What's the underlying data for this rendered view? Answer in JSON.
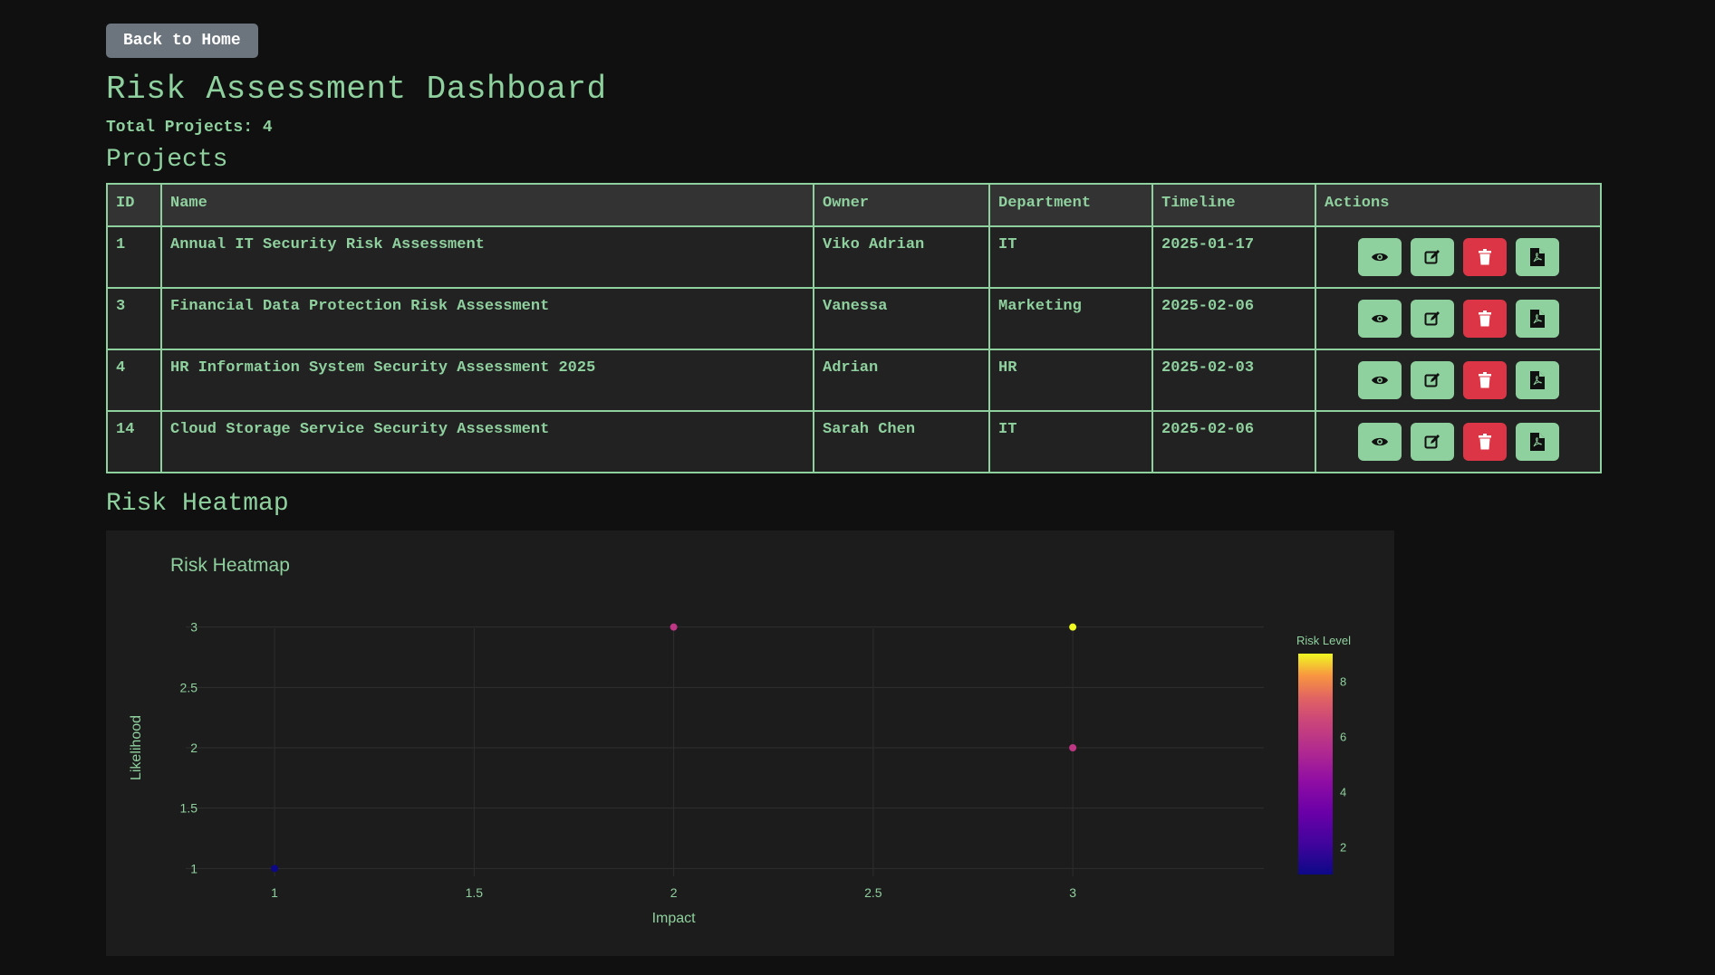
{
  "nav": {
    "back_label": "Back to Home"
  },
  "header": {
    "title": "Risk Assessment Dashboard",
    "total_projects": "Total Projects: 4"
  },
  "projects": {
    "section_title": "Projects",
    "columns": [
      "ID",
      "Name",
      "Owner",
      "Department",
      "Timeline",
      "Actions"
    ],
    "rows": [
      {
        "id": "1",
        "name": "Annual IT Security Risk Assessment",
        "owner": "Viko Adrian",
        "department": "IT",
        "timeline": "2025-01-17"
      },
      {
        "id": "3",
        "name": "Financial Data Protection Risk Assessment",
        "owner": "Vanessa",
        "department": "Marketing",
        "timeline": "2025-02-06"
      },
      {
        "id": "4",
        "name": "HR Information System Security Assessment 2025",
        "owner": "Adrian",
        "department": "HR",
        "timeline": "2025-02-03"
      },
      {
        "id": "14",
        "name": "Cloud Storage Service Security Assessment",
        "owner": "Sarah Chen",
        "department": "IT",
        "timeline": "2025-02-06"
      }
    ],
    "action_icons": [
      "eye-icon",
      "edit-icon",
      "trash-icon",
      "pdf-icon"
    ]
  },
  "heatmap_section": {
    "title": "Risk Heatmap"
  },
  "colors": {
    "accent": "#8fd19e",
    "danger": "#dc3545",
    "secondary": "#6c757d",
    "background": "#101010"
  },
  "chart_data": {
    "type": "scatter",
    "title": "Risk Heatmap",
    "xlabel": "Impact",
    "ylabel": "Likelihood",
    "xlim": [
      0.85,
      3.12
    ],
    "ylim": [
      0.95,
      3.05
    ],
    "xticks": [
      1,
      1.5,
      2,
      2.5,
      3
    ],
    "yticks": [
      1,
      1.5,
      2,
      2.5,
      3
    ],
    "grid": true,
    "colorbar": {
      "title": "Risk Level",
      "range": [
        1,
        9
      ],
      "ticks": [
        2,
        4,
        6,
        8
      ],
      "colorscale": "plasma"
    },
    "points": [
      {
        "x": 1,
        "y": 1,
        "risk": 1
      },
      {
        "x": 2,
        "y": 3,
        "risk": 6
      },
      {
        "x": 3,
        "y": 3,
        "risk": 9
      },
      {
        "x": 3,
        "y": 2,
        "risk": 6
      }
    ]
  }
}
